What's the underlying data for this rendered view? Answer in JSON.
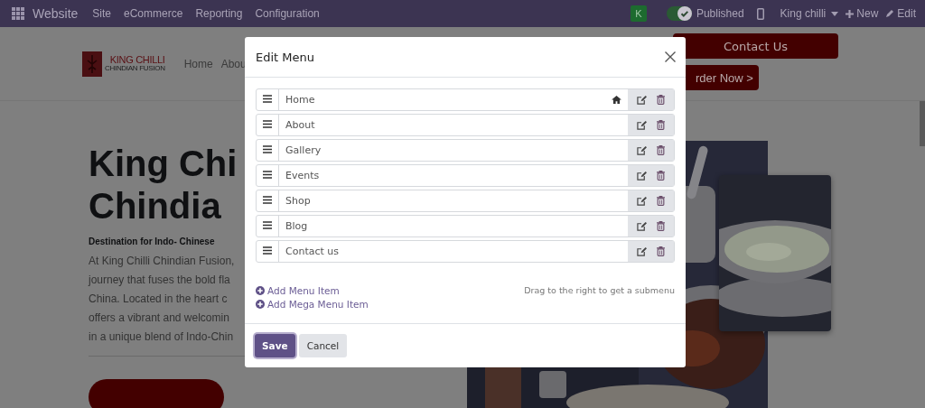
{
  "navbar": {
    "app_name": "Website",
    "menu": [
      "Site",
      "eCommerce",
      "Reporting",
      "Configuration"
    ],
    "avatar_letter": "K",
    "published": {
      "label": "Published",
      "on": true
    },
    "user": "King chilli",
    "new_label": "New",
    "edit_label": "Edit"
  },
  "site_header": {
    "logo_title": "KING CHILLI",
    "logo_subtitle": "CHINDIAN FUSION",
    "nav": [
      "Home",
      "Abou"
    ],
    "contact_button": "Contact Us",
    "order_button": "rder Now >"
  },
  "hero": {
    "title_lines": [
      "King Chi",
      "Chindia"
    ],
    "subtitle": "Destination for Indo- Chinese",
    "paragraph_lines": [
      "At King Chilli Chindian Fusion,",
      "journey that fuses the bold fla",
      "China. Located in the heart c",
      "offers a vibrant and welcomin",
      "in a unique blend of Indo-Chin"
    ]
  },
  "modal": {
    "title": "Edit Menu",
    "items": [
      {
        "label": "Home",
        "home": true
      },
      {
        "label": "About",
        "home": false
      },
      {
        "label": "Gallery",
        "home": false
      },
      {
        "label": "Events",
        "home": false
      },
      {
        "label": "Shop",
        "home": false
      },
      {
        "label": "Blog",
        "home": false
      },
      {
        "label": "Contact us",
        "home": false
      }
    ],
    "add_links": [
      "Add Menu Item",
      "Add Mega Menu Item"
    ],
    "hint": "Drag to the right to get a submenu",
    "buttons": [
      {
        "label": "Save",
        "kind": "primary"
      },
      {
        "label": "Cancel",
        "kind": "secondary"
      }
    ]
  }
}
